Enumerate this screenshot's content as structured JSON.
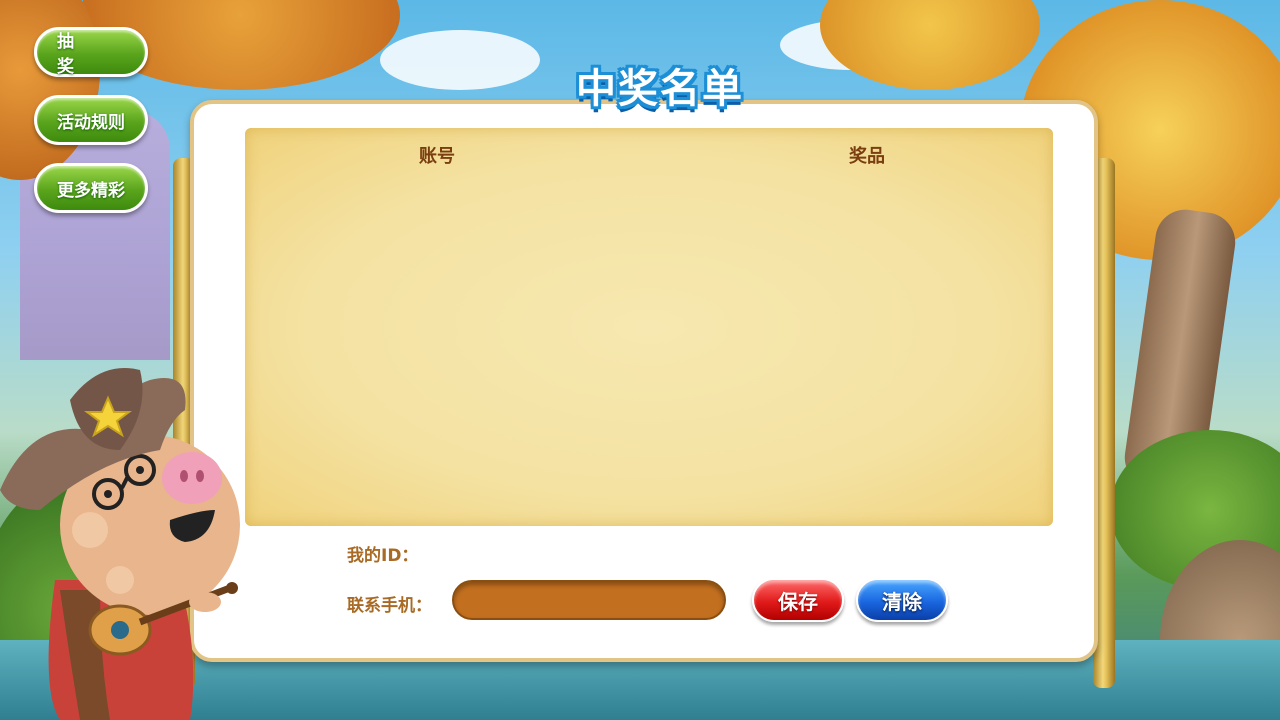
{
  "menu": {
    "items": [
      {
        "label": "抽 奖"
      },
      {
        "label": "活动规则"
      },
      {
        "label": "更多精彩"
      }
    ]
  },
  "panel": {
    "title": "中奖名单",
    "columns": {
      "account": "账号",
      "prize": "奖品"
    },
    "winners": [],
    "my_id_label": "我的ID：",
    "my_id_value": "",
    "phone_label": "联系手机：",
    "phone_value": "",
    "save_label": "保存",
    "clear_label": "清除"
  },
  "colors": {
    "menu_green": "#5aa51c",
    "save_red": "#e11a1a",
    "clear_blue": "#1a66e0",
    "input_brown": "#c26f1f",
    "list_bg": "#f4e2a2",
    "title_blue": "#1d8fd6"
  }
}
